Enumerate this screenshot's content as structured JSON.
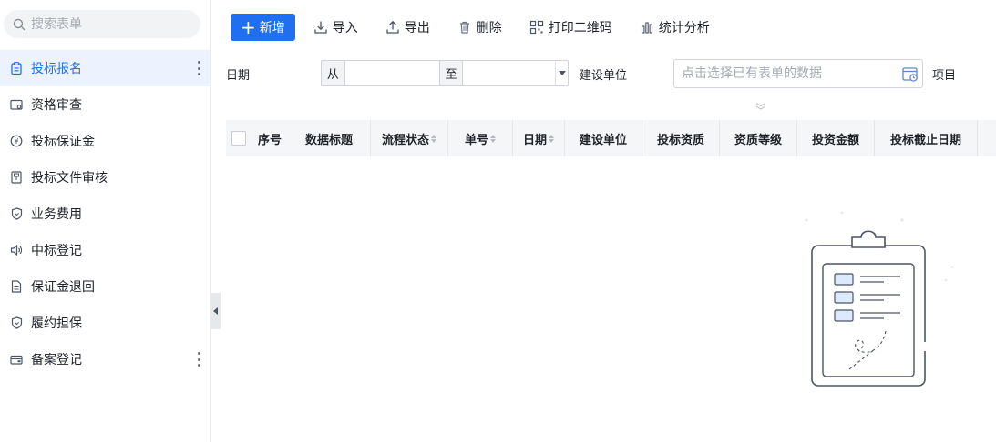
{
  "sidebar": {
    "search": {
      "placeholder": "搜索表单"
    },
    "items": [
      {
        "label": "投标报名",
        "icon": "clipboard-icon",
        "active": true,
        "has_more": true
      },
      {
        "label": "资格审查",
        "icon": "card-icon",
        "active": false,
        "has_more": false
      },
      {
        "label": "投标保证金",
        "icon": "coin-icon",
        "active": false,
        "has_more": false
      },
      {
        "label": "投标文件审核",
        "icon": "document-icon",
        "active": false,
        "has_more": false
      },
      {
        "label": "业务费用",
        "icon": "shield-icon",
        "active": false,
        "has_more": false
      },
      {
        "label": "中标登记",
        "icon": "speaker-icon",
        "active": false,
        "has_more": false
      },
      {
        "label": "保证金退回",
        "icon": "file-icon",
        "active": false,
        "has_more": false
      },
      {
        "label": "履约担保",
        "icon": "shield-icon",
        "active": false,
        "has_more": false
      },
      {
        "label": "备案登记",
        "icon": "wallet-icon",
        "active": false,
        "has_more": true
      }
    ]
  },
  "toolbar": {
    "new_label": "新增",
    "import_label": "导入",
    "export_label": "导出",
    "delete_label": "删除",
    "qrcode_label": "打印二维码",
    "stats_label": "统计分析"
  },
  "filter": {
    "date_label": "日期",
    "from_label": "从",
    "to_label": "至",
    "unit_label": "建设单位",
    "unit_placeholder": "点击选择已有表单的数据",
    "project_label": "项目"
  },
  "table": {
    "columns": [
      {
        "label": "序号",
        "sortable": false
      },
      {
        "label": "数据标题",
        "sortable": false
      },
      {
        "label": "流程状态",
        "sortable": true
      },
      {
        "label": "单号",
        "sortable": true
      },
      {
        "label": "日期",
        "sortable": true
      },
      {
        "label": "建设单位",
        "sortable": false
      },
      {
        "label": "投标资质",
        "sortable": false
      },
      {
        "label": "资质等级",
        "sortable": false
      },
      {
        "label": "投资金额",
        "sortable": false
      },
      {
        "label": "投标截止日期",
        "sortable": false
      }
    ],
    "rows": []
  },
  "colors": {
    "accent": "#1f6ff0",
    "header_bg": "#f5f6f8",
    "active_bg": "#edf3fe"
  }
}
